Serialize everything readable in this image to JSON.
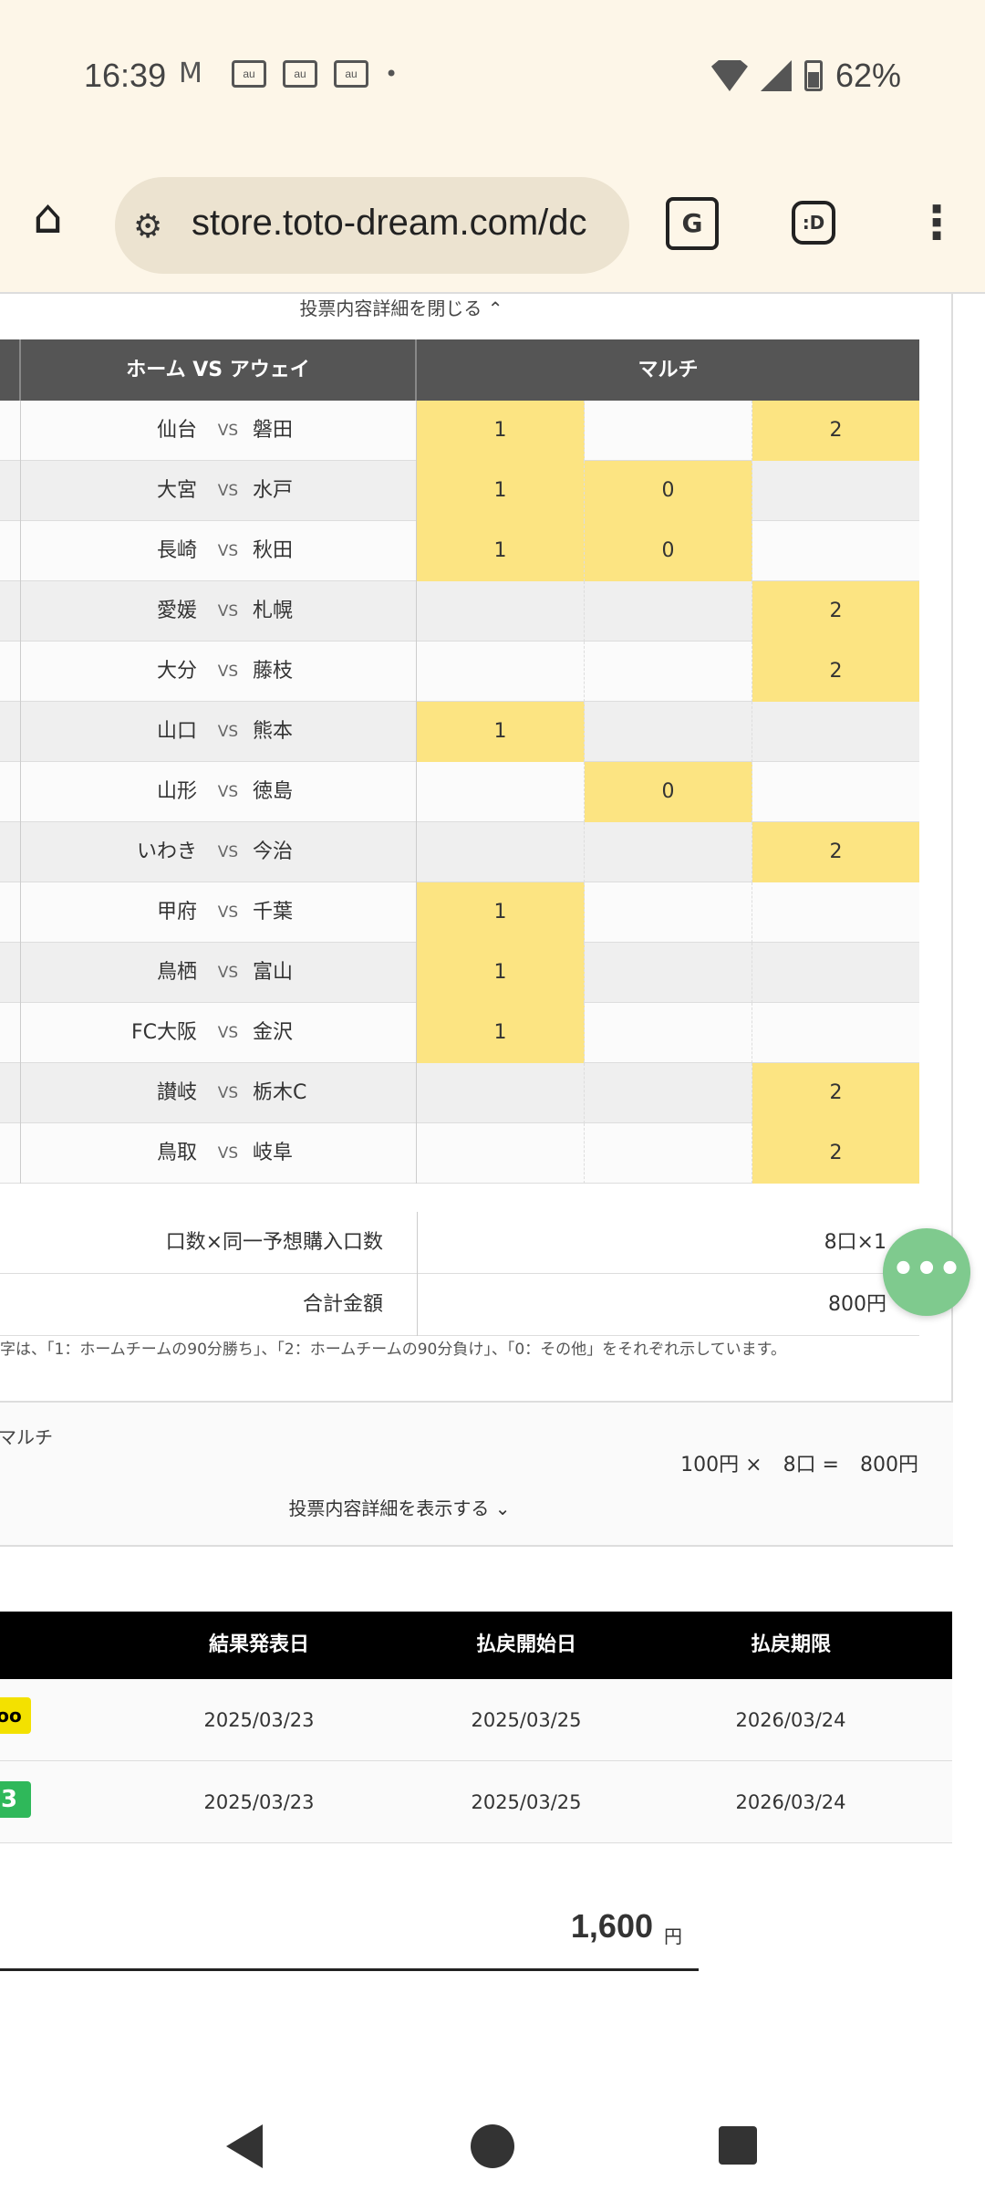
{
  "status": {
    "time": "16:39",
    "battery": "62%",
    "mail_icon": "gmail-icon",
    "notif_icon_text": "au"
  },
  "browser": {
    "url": "store.toto-dream.com/dc",
    "home_icon": "home-icon",
    "translate_icon_text": "G",
    "ext_icon_text": ":D"
  },
  "detail": {
    "close_label": "投票内容詳細を閉じる ⌃",
    "headers": {
      "match": "ホーム VS アウェイ",
      "multi": "マルチ"
    },
    "vs": "VS",
    "rows": [
      {
        "home": "仙台",
        "away": "磐田",
        "c1": "1",
        "c0": "",
        "c2": "2"
      },
      {
        "home": "大宮",
        "away": "水戸",
        "c1": "1",
        "c0": "0",
        "c2": ""
      },
      {
        "home": "長崎",
        "away": "秋田",
        "c1": "1",
        "c0": "0",
        "c2": ""
      },
      {
        "home": "愛媛",
        "away": "札幌",
        "c1": "",
        "c0": "",
        "c2": "2"
      },
      {
        "home": "大分",
        "away": "藤枝",
        "c1": "",
        "c0": "",
        "c2": "2"
      },
      {
        "home": "山口",
        "away": "熊本",
        "c1": "1",
        "c0": "",
        "c2": ""
      },
      {
        "home": "山形",
        "away": "徳島",
        "c1": "",
        "c0": "0",
        "c2": ""
      },
      {
        "home": "いわき",
        "away": "今治",
        "c1": "",
        "c0": "",
        "c2": "2"
      },
      {
        "home": "甲府",
        "away": "千葉",
        "c1": "1",
        "c0": "",
        "c2": ""
      },
      {
        "home": "鳥栖",
        "away": "富山",
        "c1": "1",
        "c0": "",
        "c2": ""
      },
      {
        "home": "FC大阪",
        "away": "金沢",
        "c1": "1",
        "c0": "",
        "c2": ""
      },
      {
        "home": "讃岐",
        "away": "栃木C",
        "c1": "",
        "c0": "",
        "c2": "2"
      },
      {
        "home": "鳥取",
        "away": "岐阜",
        "c1": "",
        "c0": "",
        "c2": "2"
      }
    ],
    "units_label": "口数×同一予想購入口数",
    "units_value": "8口×1",
    "total_label": "合計金額",
    "total_value": "800円",
    "note": "字は、「1：ホームチームの90分勝ち」、「2：ホームチームの90分負け」、「0：その他」をそれぞれ示しています。"
  },
  "summary": {
    "label": "マルチ",
    "price": "100円 ×",
    "units": "8口 =",
    "amount": "800円",
    "show_detail": "投票内容詳細を表示する ⌄"
  },
  "results": {
    "headers": [
      "結果発表日",
      "払戻開始日",
      "払戻期限"
    ],
    "rows": [
      {
        "logo": "oo",
        "announce": "2025/03/23",
        "start": "2025/03/25",
        "deadline": "2026/03/24"
      },
      {
        "logo": "3",
        "announce": "2025/03/23",
        "start": "2025/03/25",
        "deadline": "2026/03/24"
      }
    ]
  },
  "grand_total": {
    "value": "1,600",
    "unit": "円"
  },
  "fab_label": "•••"
}
